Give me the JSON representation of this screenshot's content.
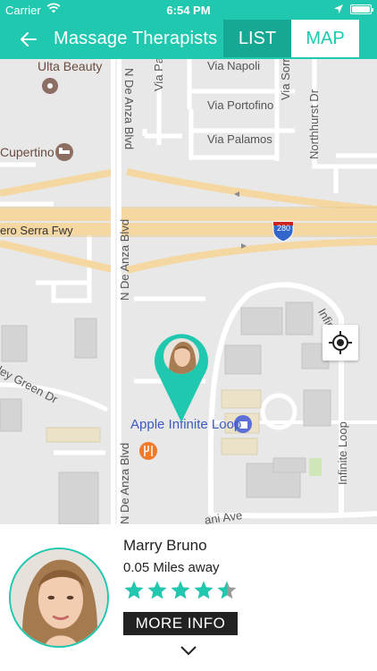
{
  "status_bar": {
    "carrier": "Carrier",
    "time": "6:54 PM",
    "icons": [
      "wifi-icon",
      "location-arrow-icon",
      "battery-icon"
    ]
  },
  "header": {
    "title": "Massage Therapists",
    "back_icon": "back-arrow-icon",
    "tabs": [
      {
        "label": "LIST",
        "selected": false
      },
      {
        "label": "MAP",
        "selected": true
      }
    ]
  },
  "map": {
    "labels": {
      "ulta": "Ulta Beauty",
      "cupertino": "Cupertino",
      "serra": "ero Serra Fwy",
      "highway": "280",
      "de_anza_1": "N De Anza Blvd",
      "de_anza_2": "N De Anza Blvd",
      "de_anza_3": "N De Anza Blvd",
      "via_napoli": "Via Napoli",
      "via_portofino": "Via Portofino",
      "via_palamos": "Via Palamos",
      "via_pa": "Via Pa",
      "via_sorrento": "Via Sorrent",
      "northhurst": "Northhurst Dr",
      "infinite_loop_1": "Infinite Loop",
      "infinite_loop_2": "Infin",
      "valley_green": "ley Green Dr",
      "mariani": "ani Ave",
      "apple": "Apple Infinite Loop"
    },
    "pin_icon": "map-pin-icon",
    "locate_icon": "crosshair-locate-icon"
  },
  "therapist": {
    "name": "Marry Bruno",
    "distance": "0.05 Miles away",
    "rating": 4.5,
    "rating_max": 5,
    "more_info_label": "MORE INFO",
    "expand_icon": "chevron-down-icon"
  },
  "colors": {
    "accent": "#20c8b0",
    "accent_dark": "#16a892",
    "road_major": "#f5d7a1",
    "map_bg": "#e8e8e8",
    "poi_blue": "#3d5bbf",
    "food_orange": "#f07a2a"
  }
}
